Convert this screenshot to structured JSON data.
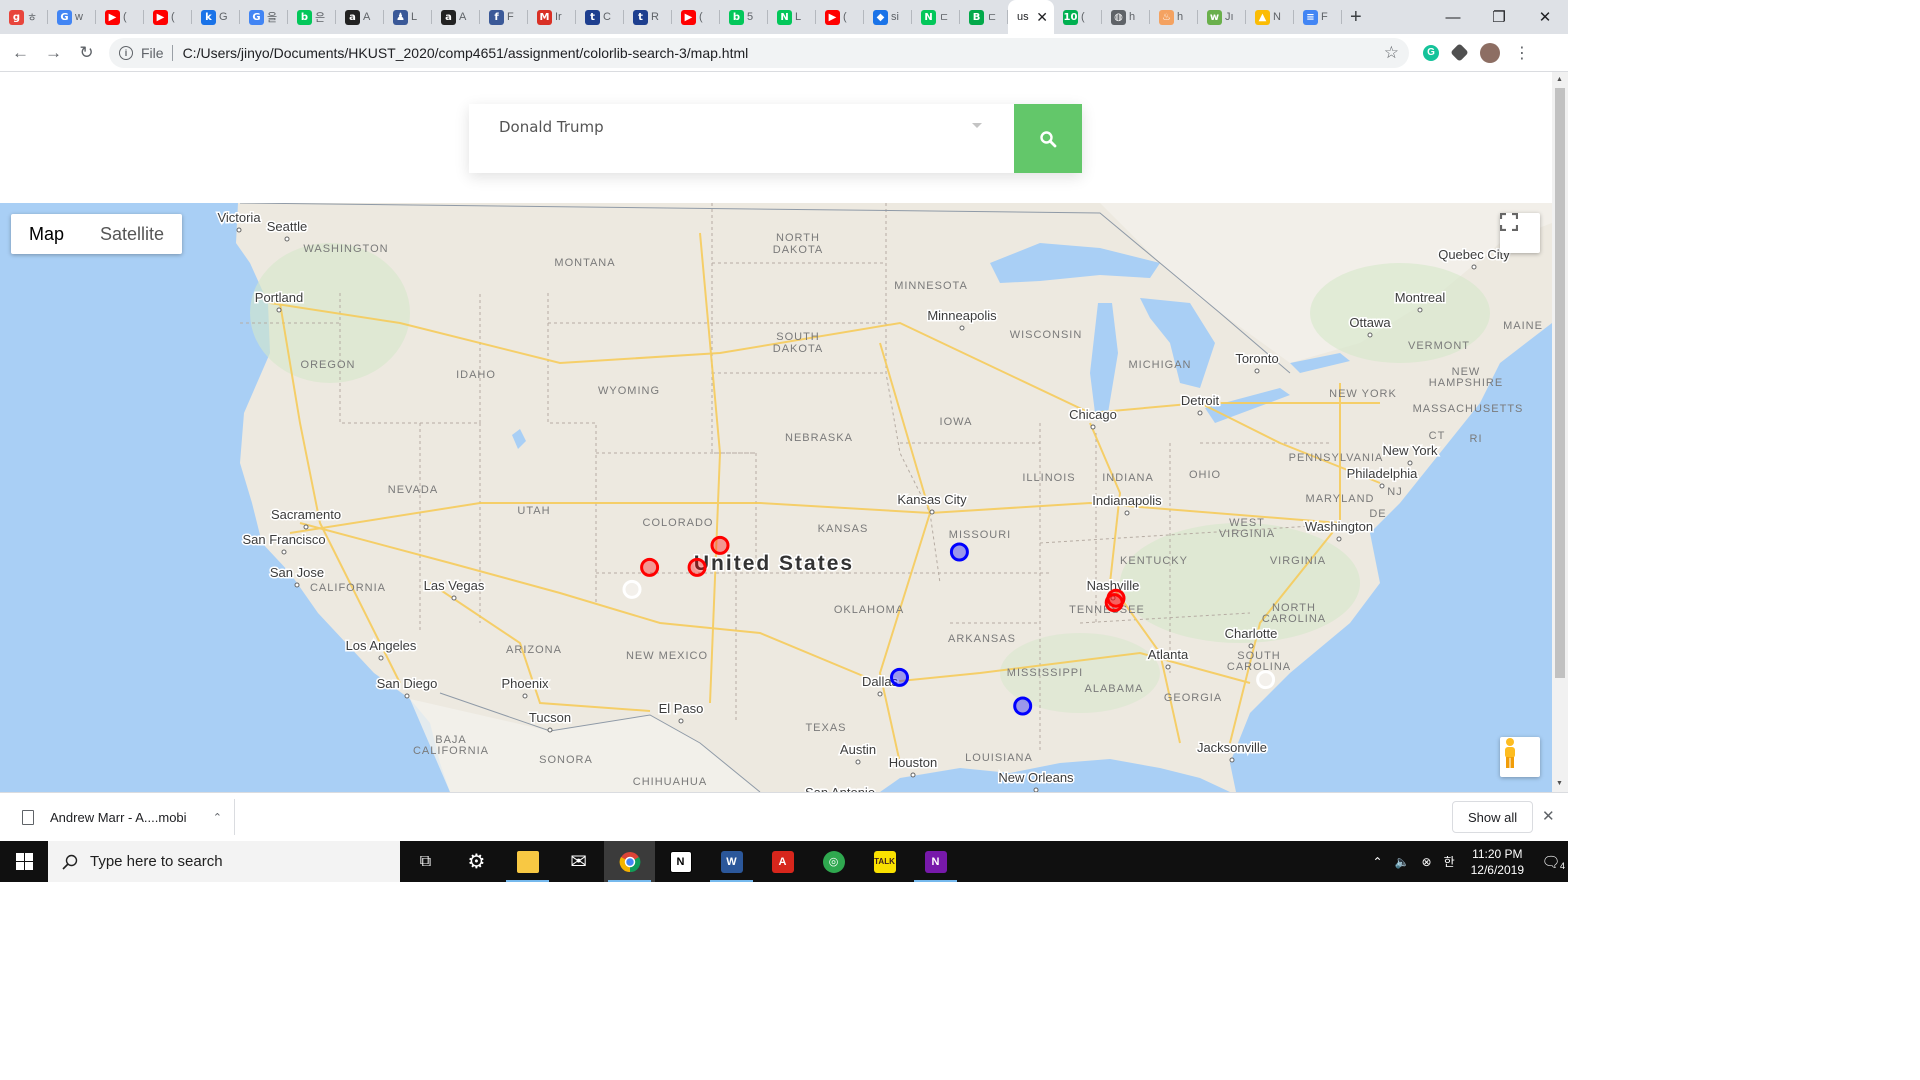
{
  "browser": {
    "tabs": [
      {
        "label": "ㅎ",
        "icon": "tab-favicon-g-script",
        "color": "#e8453c",
        "glyph": "g"
      },
      {
        "label": "w",
        "icon": "tab-favicon-google",
        "color": "#4285f4",
        "glyph": "G"
      },
      {
        "label": "(",
        "icon": "tab-favicon-youtube",
        "color": "#ff0000",
        "glyph": "▶"
      },
      {
        "label": "(",
        "icon": "tab-favicon-youtube",
        "color": "#ff0000",
        "glyph": "▶"
      },
      {
        "label": "G",
        "icon": "tab-favicon-k",
        "color": "#1a73e8",
        "glyph": "k"
      },
      {
        "label": "을",
        "icon": "tab-favicon-google",
        "color": "#4285f4",
        "glyph": "G"
      },
      {
        "label": "은",
        "icon": "tab-favicon-blog",
        "color": "#03c75a",
        "glyph": "b"
      },
      {
        "label": "A",
        "icon": "tab-favicon-amazon",
        "color": "#222222",
        "glyph": "a"
      },
      {
        "label": "L",
        "icon": "tab-favicon-person",
        "color": "#3b5998",
        "glyph": "♟"
      },
      {
        "label": "A",
        "icon": "tab-favicon-amazon",
        "color": "#222222",
        "glyph": "a"
      },
      {
        "label": "F",
        "icon": "tab-favicon-facebook",
        "color": "#3b5998",
        "glyph": "f"
      },
      {
        "label": "Ir",
        "icon": "tab-favicon-gmail",
        "color": "#d93025",
        "glyph": "M"
      },
      {
        "label": "C",
        "icon": "tab-favicon-tsc",
        "color": "#1e3f8f",
        "glyph": "t"
      },
      {
        "label": "R",
        "icon": "tab-favicon-tsc",
        "color": "#1e3f8f",
        "glyph": "t"
      },
      {
        "label": "(",
        "icon": "tab-favicon-youtube",
        "color": "#ff0000",
        "glyph": "▶"
      },
      {
        "label": "5",
        "icon": "tab-favicon-blog",
        "color": "#03c75a",
        "glyph": "b"
      },
      {
        "label": "L",
        "icon": "tab-favicon-naver",
        "color": "#03c75a",
        "glyph": "N"
      },
      {
        "label": "(",
        "icon": "tab-favicon-youtube",
        "color": "#ff0000",
        "glyph": "▶"
      },
      {
        "label": "si",
        "icon": "tab-favicon-diamond",
        "color": "#1a73e8",
        "glyph": "◆"
      },
      {
        "label": "ㄷ",
        "icon": "tab-favicon-naver",
        "color": "#03c75a",
        "glyph": "N"
      },
      {
        "label": "ㄷ",
        "icon": "tab-favicon-b-green",
        "color": "#03a94a",
        "glyph": "B"
      }
    ],
    "active_tab": {
      "label": "us",
      "close": "✕"
    },
    "tabs_after": [
      {
        "label": "(",
        "icon": "tab-favicon-10",
        "color": "#00b050",
        "glyph": "10"
      },
      {
        "label": "h",
        "icon": "tab-favicon-globe",
        "color": "#5f6368",
        "glyph": "◍"
      },
      {
        "label": "h",
        "icon": "tab-favicon-flame",
        "color": "#f4a261",
        "glyph": "♨"
      },
      {
        "label": "Jı",
        "icon": "tab-favicon-web",
        "color": "#6ab04c",
        "glyph": "w"
      },
      {
        "label": "N",
        "icon": "tab-favicon-drive",
        "color": "#fbbc04",
        "glyph": "▲"
      },
      {
        "label": "F",
        "icon": "tab-favicon-forms",
        "color": "#4285f4",
        "glyph": "≡"
      }
    ],
    "new_tab": "+",
    "window_controls": {
      "minimize": "—",
      "maximize": "❐",
      "close": "✕"
    },
    "nav": {
      "back": "←",
      "forward": "→",
      "reload": "↻"
    },
    "address": {
      "scheme_label": "File",
      "url": "C:/Users/jinyo/Documents/HKUST_2020/comp4651/assignment/colorlib-search-3/map.html"
    },
    "bookmark_star": "☆"
  },
  "search": {
    "selected_value": "Donald Trump"
  },
  "map": {
    "type_buttons": {
      "map": "Map",
      "satellite": "Satellite"
    },
    "country_label": "United States",
    "state_labels": [
      "WASHINGTON",
      "MONTANA",
      "NORTH",
      "DAKOTA",
      "MINNESOTA",
      "OREGON",
      "IDAHO",
      "SOUTH",
      "DAKOTA",
      "WYOMING",
      "WISCONSIN",
      "MICHIGAN",
      "IOWA",
      "NEBRASKA",
      "NEVADA",
      "UTAH",
      "COLORADO",
      "KANSAS",
      "MISSOURI",
      "ILLINOIS",
      "INDIANA",
      "OHIO",
      "CALIFORNIA",
      "ARIZONA",
      "NEW MEXICO",
      "OKLAHOMA",
      "ARKANSAS",
      "TENNESSEE",
      "KENTUCKY",
      "WEST",
      "VIRGINIA",
      "VIRGINIA",
      "NORTH",
      "CAROLINA",
      "SOUTH",
      "CAROLINA",
      "MISSISSIPPI",
      "ALABAMA",
      "GEORGIA",
      "TEXAS",
      "LOUISIANA",
      "PENNSYLVANIA",
      "NEW YORK",
      "VERMONT",
      "NEW",
      "HAMPSHIRE",
      "MASSACHUSETTS",
      "MAINE",
      "CT",
      "RI",
      "NJ",
      "MARYLAND",
      "DE",
      "BAJA",
      "CALIFORNIA",
      "SONORA",
      "CHIHUAHUA"
    ],
    "city_labels": [
      "Victoria",
      "Seattle",
      "Portland",
      "Sacramento",
      "San Francisco",
      "San Jose",
      "Las Vegas",
      "Los Angeles",
      "San Diego",
      "Phoenix",
      "Tucson",
      "El Paso",
      "Dallas",
      "Austin",
      "Houston",
      "San Antonio",
      "New Orleans",
      "Kansas City",
      "Minneapolis",
      "Chicago",
      "Detroit",
      "Toronto",
      "Ottawa",
      "Montreal",
      "Quebec City",
      "Indianapolis",
      "Nashville",
      "Atlanta",
      "Charlotte",
      "Jacksonville",
      "Washington",
      "Philadelphia",
      "New York"
    ],
    "markers": [
      {
        "color": "#ff0000",
        "lat": 41.2,
        "lon": -112.0
      },
      {
        "color": "#ff0000",
        "lat": 40.2,
        "lon": -116.0
      },
      {
        "color": "#ff0000",
        "lat": 40.2,
        "lon": -113.3
      },
      {
        "color": "#ff0000",
        "lat": 38.8,
        "lon": -89.5
      },
      {
        "color": "#ff0000",
        "lat": 38.6,
        "lon": -89.6
      },
      {
        "color": "#0000ff",
        "lat": 40.9,
        "lon": -98.4
      },
      {
        "color": "#0000ff",
        "lat": 35.2,
        "lon": -101.8
      },
      {
        "color": "#0000ff",
        "lat": 33.9,
        "lon": -94.8
      },
      {
        "color": "#ffffff",
        "lat": 39.2,
        "lon": -117.0
      },
      {
        "color": "#ffffff",
        "lat": 35.1,
        "lon": -81.0
      }
    ]
  },
  "downloads": {
    "file_name": "Andrew Marr - A....mobi",
    "chevron": "⌃",
    "show_all": "Show all",
    "close": "✕"
  },
  "taskbar": {
    "search_placeholder": "Type here to search",
    "apps": [
      "task-view",
      "settings",
      "file-explorer",
      "mail",
      "chrome",
      "notion",
      "word",
      "acrobat",
      "browser-green",
      "kakaotalk",
      "onenote"
    ],
    "tray": {
      "language": "한",
      "time": "11:20 PM",
      "date": "12/6/2019",
      "notification_count": "4"
    }
  }
}
